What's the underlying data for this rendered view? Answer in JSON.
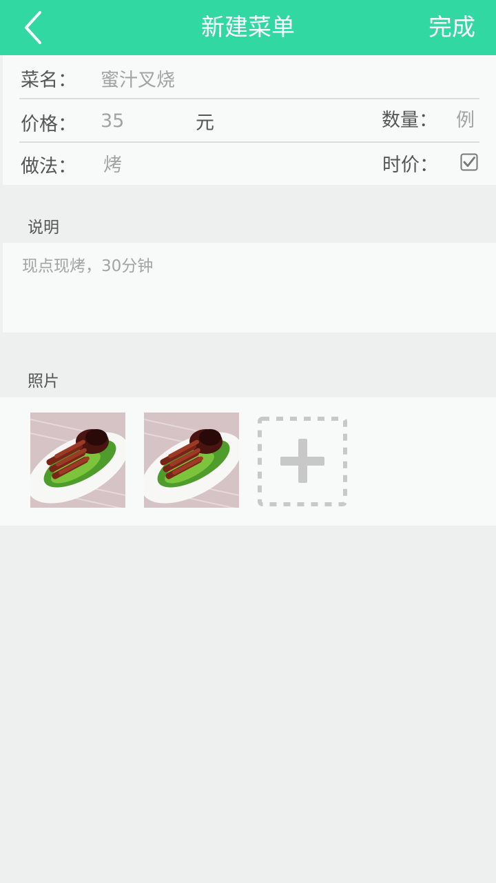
{
  "header": {
    "title": "新建菜单",
    "done_label": "完成",
    "back_icon": "chevron-left-icon",
    "background_color": "#32d8a2"
  },
  "form": {
    "name_label": "菜名：",
    "name_value": "蜜汁叉烧",
    "price_label": "价格：",
    "price_value": "35",
    "price_unit": "元",
    "quantity_label": "数量：",
    "quantity_placeholder": "例",
    "method_label": "做法：",
    "method_value": "烤",
    "market_price_label": "时价：",
    "market_price_checked": true
  },
  "description": {
    "label": "说明",
    "text": "现点现烤，30分钟"
  },
  "photos": {
    "label": "照片",
    "count": 2,
    "add_icon": "plus-icon"
  }
}
